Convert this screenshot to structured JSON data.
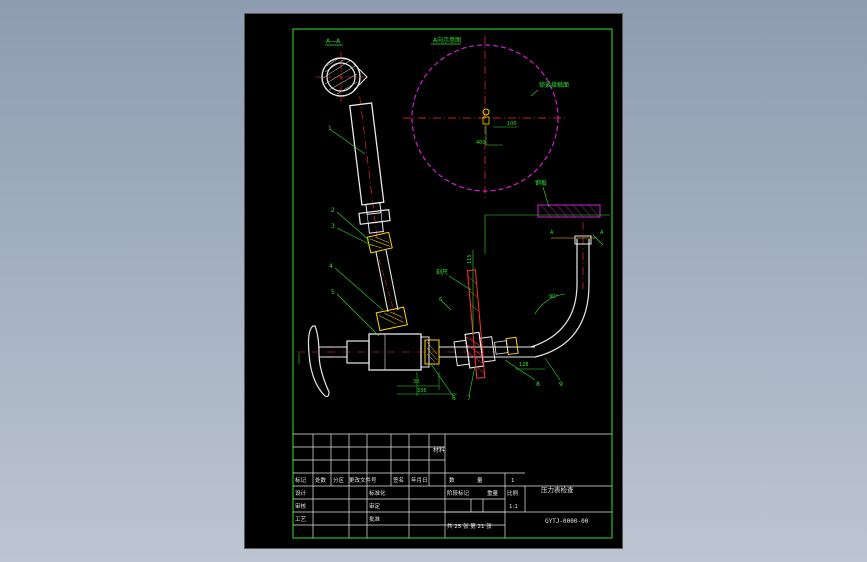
{
  "labels": {
    "section_aa": "A—A",
    "view_title": "A向示意图",
    "connector_label": "锁紧接触面",
    "pipe_label": "钢板",
    "handle_label": "刻尺",
    "dim_100": "100",
    "dim_400": "400",
    "dim_90": "90°",
    "dim_115": "115",
    "dim_30": "30",
    "dim_336": "336",
    "dim_128": "128",
    "dim_6": "6",
    "letter_a1": "A",
    "letter_a2": "A",
    "parts": [
      "1",
      "2",
      "3",
      "4",
      "5",
      "6",
      "7",
      "8",
      "9"
    ]
  },
  "title_block": {
    "material_label": "材料",
    "row1": [
      "标记",
      "处数",
      "分区",
      "更改文件号",
      "签名",
      "年月日"
    ],
    "row2": [
      "设计",
      "",
      "",
      "标准化"
    ],
    "row3": [
      "审核",
      "",
      "",
      "审定"
    ],
    "row4": [
      "工艺",
      "",
      "",
      "批准"
    ],
    "col_headers": [
      "数",
      "量",
      "1"
    ],
    "stage_label": "阶段标记",
    "weight_label": "重量",
    "scale_label": "比例",
    "scale_value": "1:1",
    "sheets_text": "共 25 张 第 21 张",
    "drawing_name": "压力表检查",
    "drawing_code": "GYTJ-0000-00"
  }
}
